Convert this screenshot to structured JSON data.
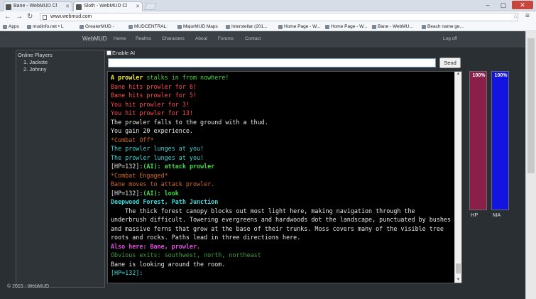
{
  "browser": {
    "tabs": [
      {
        "title": "Bane - WebMUD Cl",
        "active": false
      },
      {
        "title": "Sloth - WebMUD Cl",
        "active": true
      }
    ],
    "url": "www.webmud.com",
    "bookmarks": [
      "Apps",
      "mudinfo.net • L",
      "GreaterMUD -",
      "MUDCENTRAL:",
      "MajorMUD Maps",
      "Interstellar (201...",
      "Home Page - W...",
      "Home Page - W...",
      "Bane - WebMU...",
      "Beach name ge..."
    ]
  },
  "nav": {
    "brand": "WebMUD",
    "links": [
      "Home",
      "Realms",
      "Characters",
      "About",
      "Forums",
      "Contact"
    ],
    "logoff": "Log off"
  },
  "sidebar": {
    "title": "Online Players",
    "players": [
      "1. Jackote",
      "2. Johnny"
    ]
  },
  "controls": {
    "enable_ai_label": "Enable AI",
    "input_value": "",
    "send_label": "Send"
  },
  "terminal": {
    "lines": [
      {
        "segs": [
          {
            "t": "A prowler ",
            "c": "t-yellow t-bold"
          },
          {
            "t": "stalks in from nowhere!",
            "c": "t-green"
          }
        ]
      },
      {
        "segs": [
          {
            "t": "Bane hits prowler for 6!",
            "c": "t-red"
          }
        ]
      },
      {
        "segs": [
          {
            "t": "Bane hits prowler for 5!",
            "c": "t-red"
          }
        ]
      },
      {
        "segs": [
          {
            "t": "You hit prowler for 3!",
            "c": "t-red"
          }
        ]
      },
      {
        "segs": [
          {
            "t": "You hit prowler for 13!",
            "c": "t-red"
          }
        ]
      },
      {
        "segs": [
          {
            "t": "The prowler falls to the ground with a thud.",
            "c": "t-white"
          }
        ]
      },
      {
        "segs": [
          {
            "t": "You gain 20 experience.",
            "c": "t-white"
          }
        ]
      },
      {
        "segs": [
          {
            "t": "*Combat Off*",
            "c": "t-orange"
          }
        ]
      },
      {
        "segs": [
          {
            "t": "The prowler lunges at you!",
            "c": "t-cyan"
          }
        ]
      },
      {
        "segs": [
          {
            "t": "The prowler lunges at you!",
            "c": "t-cyan"
          }
        ]
      },
      {
        "segs": [
          {
            "t": "[HP=132]:",
            "c": "t-white"
          },
          {
            "t": "(AI): attack prowler",
            "c": "t-green t-bold"
          }
        ]
      },
      {
        "segs": [
          {
            "t": "*Combat Engaged*",
            "c": "t-orange"
          }
        ]
      },
      {
        "segs": [
          {
            "t": "Bane moves to attack prowler.",
            "c": "t-orange"
          }
        ]
      },
      {
        "segs": [
          {
            "t": "[HP=132]:",
            "c": "t-white"
          },
          {
            "t": "(AI): look",
            "c": "t-green t-bold"
          }
        ]
      },
      {
        "segs": [
          {
            "t": "Deepwood Forest, Path Junction",
            "c": "t-cyan t-bold"
          }
        ]
      },
      {
        "segs": [
          {
            "t": "    The thick forest canopy blocks out most light here, making navigation through the underbrush difficult. Towering evergreens and hardwoods dot the landscape, punctuated by bushes and massive ferns that grow at the base of their trunks. Moss covers many of the visible tree roots and rocks. Paths lead in three directions here.",
            "c": "t-white"
          }
        ]
      },
      {
        "segs": [
          {
            "t": "Also here: Bane, prowler.",
            "c": "t-magenta t-bold"
          }
        ]
      },
      {
        "segs": [
          {
            "t": "Obvious exits: southwest, north, northeast",
            "c": "t-dkgreen"
          }
        ]
      },
      {
        "segs": [
          {
            "t": "Bane is looking around the room.",
            "c": "t-white"
          }
        ]
      },
      {
        "segs": [
          {
            "t": "[HP=132]:",
            "c": "t-cyan"
          }
        ]
      }
    ]
  },
  "stats": {
    "hp": {
      "label": "HP",
      "pct_label": "100%",
      "fraction": 1.0,
      "color": "#8a1f4a"
    },
    "ma": {
      "label": "MA",
      "pct_label": "100%",
      "fraction": 1.0,
      "color": "#1414e0"
    }
  },
  "footer": {
    "text": "© 2015 - WebMUD"
  }
}
